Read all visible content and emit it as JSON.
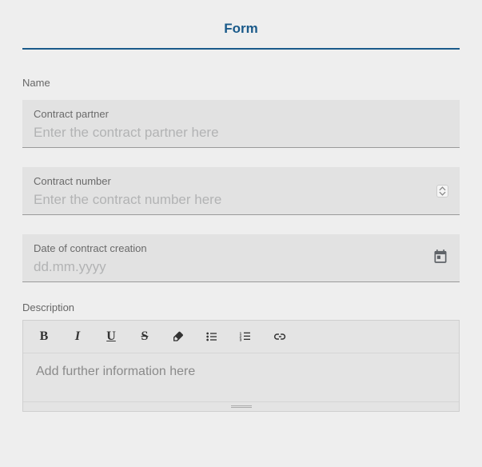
{
  "header": {
    "title": "Form"
  },
  "labels": {
    "name": "Name",
    "description": "Description"
  },
  "fields": {
    "contract_partner": {
      "label": "Contract partner",
      "placeholder": "Enter the contract partner here",
      "value": ""
    },
    "contract_number": {
      "label": "Contract number",
      "placeholder": "Enter the contract number here",
      "value": ""
    },
    "contract_date": {
      "label": "Date of contract creation",
      "placeholder": "dd.mm.yyyy",
      "value": ""
    }
  },
  "rte": {
    "placeholder": "Add further information here",
    "toolbar": {
      "bold": "B",
      "italic": "I",
      "underline": "U",
      "strike": "S",
      "erase": "erase",
      "ul": "ul",
      "ol": "ol",
      "link": "link"
    }
  }
}
